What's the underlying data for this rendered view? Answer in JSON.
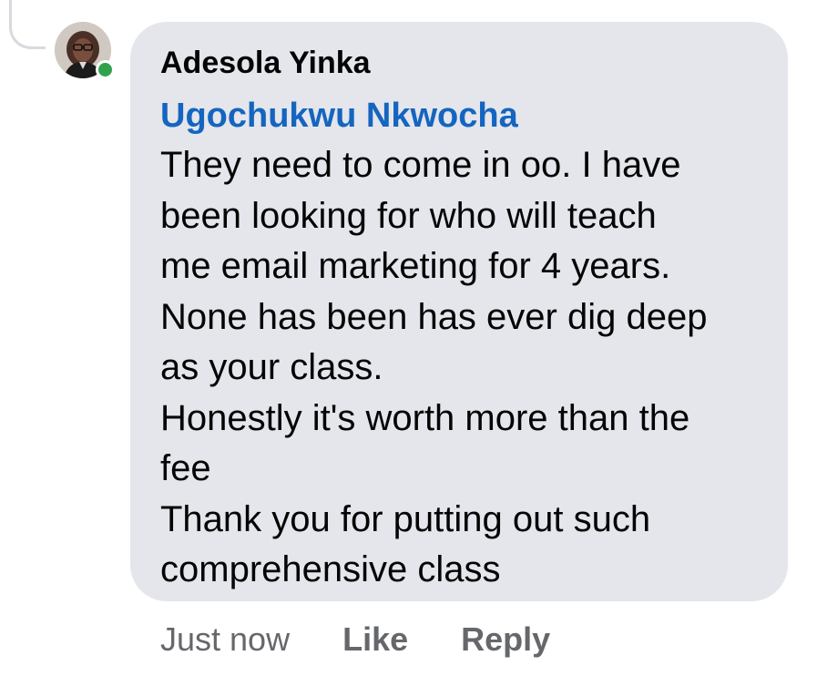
{
  "comment": {
    "author": "Adesola Yinka",
    "mention": "Ugochukwu Nkwocha",
    "lines": [
      "They need to come in oo. I have",
      "been looking for who will teach",
      "me email marketing for 4 years.",
      "None has been has ever dig deep",
      "as your class.",
      "Honestly it's worth more than the",
      "fee",
      "Thank you for putting out such",
      "comprehensive class"
    ],
    "online_status_color": "#31a24c",
    "bubble_color": "#e4e6eb",
    "mention_color": "#1565c0"
  },
  "actions": {
    "timestamp": "Just now",
    "like_label": "Like",
    "reply_label": "Reply"
  },
  "icons": {
    "avatar": "profile-photo",
    "online": "online-status-dot"
  }
}
